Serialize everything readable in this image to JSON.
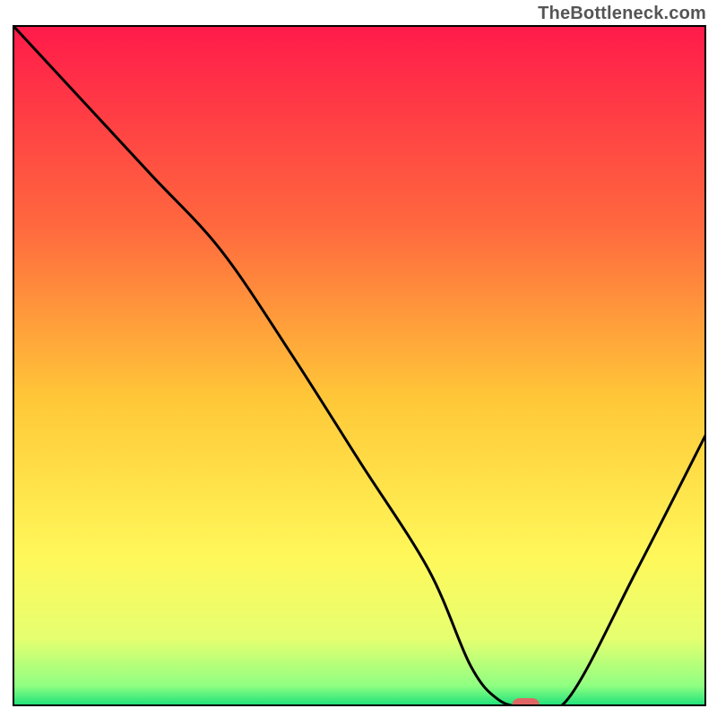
{
  "watermark": "TheBottleneck.com",
  "chart_data": {
    "type": "line",
    "title": "",
    "xlabel": "",
    "ylabel": "",
    "xlim": [
      0,
      100
    ],
    "ylim": [
      0,
      100
    ],
    "x": [
      0,
      10,
      20,
      30,
      40,
      50,
      60,
      66,
      70,
      74,
      80,
      90,
      100
    ],
    "values": [
      100,
      89,
      78,
      67,
      52,
      36,
      20,
      6,
      1,
      0,
      1,
      20,
      40
    ],
    "optimum": {
      "x": 74,
      "y": 0
    },
    "marker": {
      "x": 74,
      "y": 0,
      "color": "#e06666"
    },
    "background_gradient": [
      {
        "offset": 0.0,
        "color": "#ff1a4a"
      },
      {
        "offset": 0.3,
        "color": "#ff6a3e"
      },
      {
        "offset": 0.55,
        "color": "#ffc838"
      },
      {
        "offset": 0.78,
        "color": "#fff85a"
      },
      {
        "offset": 0.9,
        "color": "#e6ff70"
      },
      {
        "offset": 0.97,
        "color": "#8fff82"
      },
      {
        "offset": 1.0,
        "color": "#18e07a"
      }
    ]
  }
}
